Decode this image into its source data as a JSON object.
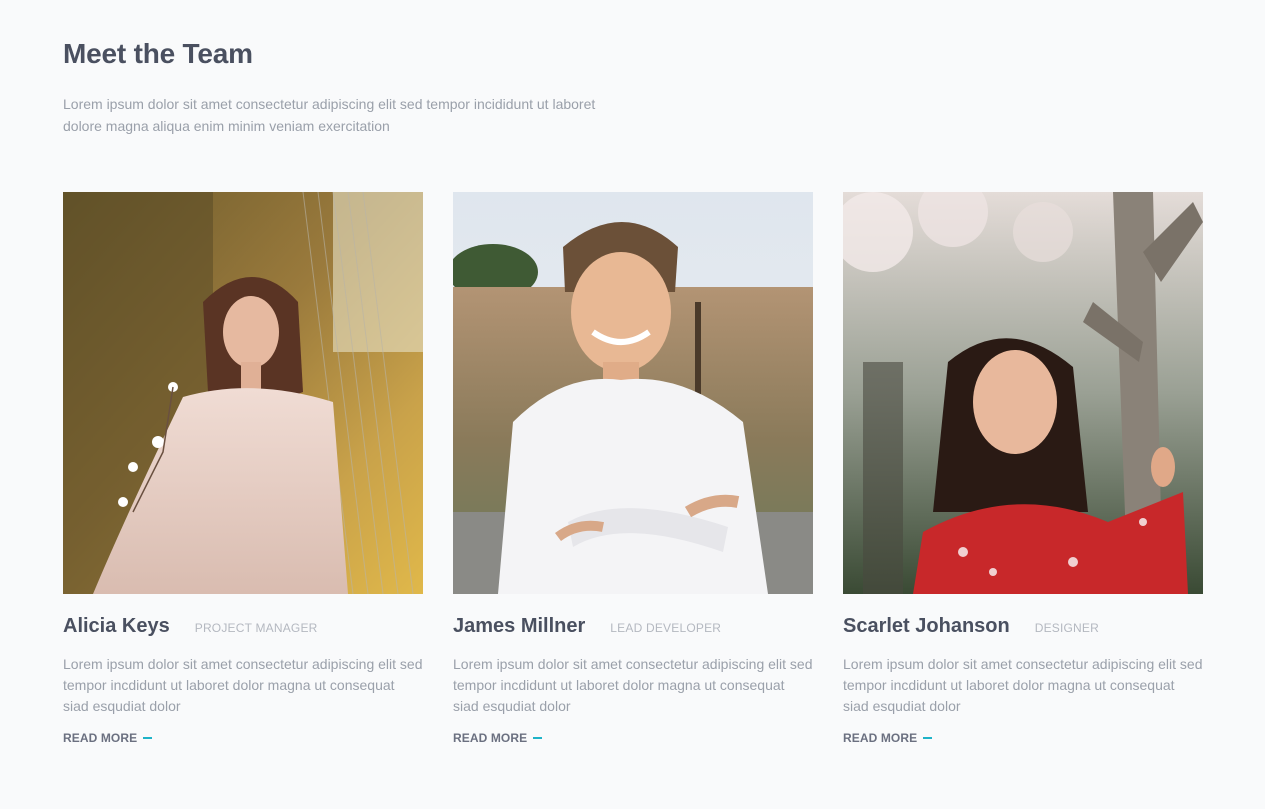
{
  "section": {
    "title": "Meet the Team",
    "intro": "Lorem ipsum dolor sit amet consectetur adipiscing elit sed tempor incididunt ut laboret dolore magna aliqua enim minim veniam exercitation"
  },
  "members": [
    {
      "name": "Alicia Keys",
      "role": "PROJECT MANAGER",
      "bio": "Lorem ipsum dolor sit amet consectetur adipiscing elit sed tempor incdidunt ut laboret dolor magna ut consequat siad esqudiat dolor",
      "link": "READ MORE"
    },
    {
      "name": "James Millner",
      "role": "LEAD DEVELOPER",
      "bio": "Lorem ipsum dolor sit amet consectetur adipiscing elit sed tempor incdidunt ut laboret dolor magna ut consequat siad esqudiat dolor",
      "link": "READ MORE"
    },
    {
      "name": "Scarlet Johanson",
      "role": "DESIGNER",
      "bio": "Lorem ipsum dolor sit amet consectetur adipiscing elit sed tempor incdidunt ut laboret dolor magna ut consequat siad esqudiat dolor",
      "link": "READ MORE"
    }
  ],
  "colors": {
    "accent": "#1fb3c8",
    "heading": "#4a5060",
    "body_text": "#9aa0aa",
    "background": "#f9fafb"
  }
}
